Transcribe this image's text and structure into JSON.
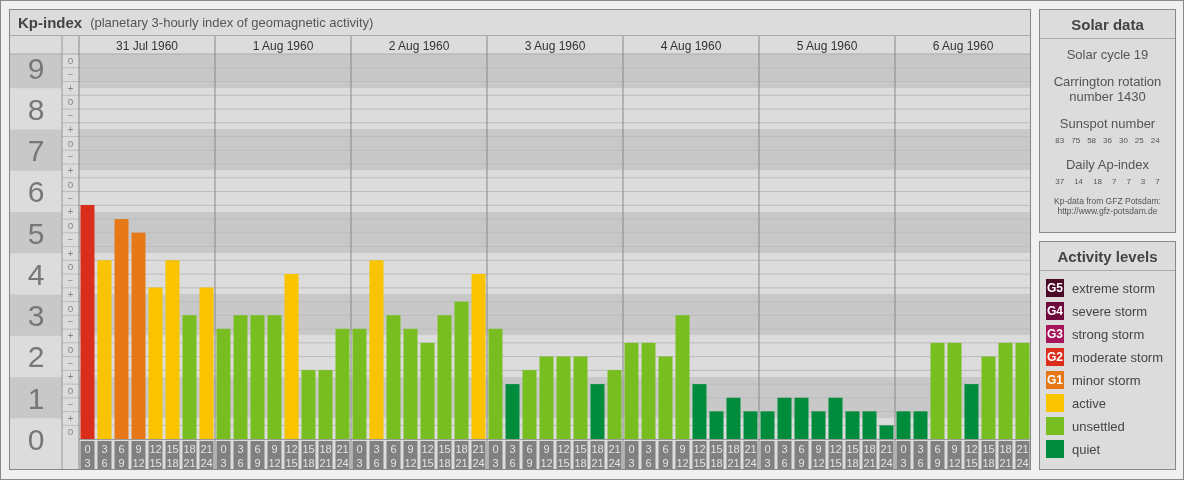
{
  "header": {
    "title": "Kp-index",
    "subtitle": "(planetary 3-hourly index of geomagnetic activity)"
  },
  "chart": {
    "sub_labels": [
      "o",
      "−",
      "+",
      "o",
      "−",
      "+",
      "o",
      "−",
      "+",
      "o",
      "−",
      "+",
      "o",
      "−",
      "+",
      "o",
      "−",
      "+",
      "o",
      "−",
      "+",
      "o",
      "−",
      "+",
      "o",
      "−",
      "+",
      "o"
    ],
    "days": [
      {
        "date": "31 Jul 1960",
        "slots": [
          {
            "from": "0",
            "to": "3"
          },
          {
            "from": "3",
            "to": "6"
          },
          {
            "from": "6",
            "to": "9"
          },
          {
            "from": "9",
            "to": "12"
          },
          {
            "from": "12",
            "to": "15"
          },
          {
            "from": "15",
            "to": "18"
          },
          {
            "from": "18",
            "to": "21"
          },
          {
            "from": "21",
            "to": "24"
          }
        ]
      },
      {
        "date": "1 Aug 1960",
        "slots": [
          {
            "from": "0",
            "to": "3"
          },
          {
            "from": "3",
            "to": "6"
          },
          {
            "from": "6",
            "to": "9"
          },
          {
            "from": "9",
            "to": "12"
          },
          {
            "from": "12",
            "to": "15"
          },
          {
            "from": "15",
            "to": "18"
          },
          {
            "from": "18",
            "to": "21"
          },
          {
            "from": "21",
            "to": "24"
          }
        ]
      },
      {
        "date": "2 Aug 1960",
        "slots": [
          {
            "from": "0",
            "to": "3"
          },
          {
            "from": "3",
            "to": "6"
          },
          {
            "from": "6",
            "to": "9"
          },
          {
            "from": "9",
            "to": "12"
          },
          {
            "from": "12",
            "to": "15"
          },
          {
            "from": "15",
            "to": "18"
          },
          {
            "from": "18",
            "to": "21"
          },
          {
            "from": "21",
            "to": "24"
          }
        ]
      },
      {
        "date": "3 Aug 1960",
        "slots": [
          {
            "from": "0",
            "to": "3"
          },
          {
            "from": "3",
            "to": "6"
          },
          {
            "from": "6",
            "to": "9"
          },
          {
            "from": "9",
            "to": "12"
          },
          {
            "from": "12",
            "to": "15"
          },
          {
            "from": "15",
            "to": "18"
          },
          {
            "from": "18",
            "to": "21"
          },
          {
            "from": "21",
            "to": "24"
          }
        ]
      },
      {
        "date": "4 Aug 1960",
        "slots": [
          {
            "from": "0",
            "to": "3"
          },
          {
            "from": "3",
            "to": "6"
          },
          {
            "from": "6",
            "to": "9"
          },
          {
            "from": "9",
            "to": "12"
          },
          {
            "from": "12",
            "to": "15"
          },
          {
            "from": "15",
            "to": "18"
          },
          {
            "from": "18",
            "to": "21"
          },
          {
            "from": "21",
            "to": "24"
          }
        ]
      },
      {
        "date": "5 Aug 1960",
        "slots": [
          {
            "from": "0",
            "to": "3"
          },
          {
            "from": "3",
            "to": "6"
          },
          {
            "from": "6",
            "to": "9"
          },
          {
            "from": "9",
            "to": "12"
          },
          {
            "from": "12",
            "to": "15"
          },
          {
            "from": "15",
            "to": "18"
          },
          {
            "from": "18",
            "to": "21"
          },
          {
            "from": "21",
            "to": "24"
          }
        ]
      },
      {
        "date": "6 Aug 1960",
        "slots": [
          {
            "from": "0",
            "to": "3"
          },
          {
            "from": "3",
            "to": "6"
          },
          {
            "from": "6",
            "to": "9"
          },
          {
            "from": "9",
            "to": "12"
          },
          {
            "from": "12",
            "to": "15"
          },
          {
            "from": "15",
            "to": "18"
          },
          {
            "from": "18",
            "to": "21"
          },
          {
            "from": "21",
            "to": "24"
          }
        ]
      }
    ],
    "chart_data": {
      "type": "bar",
      "stacked": true,
      "grid": true,
      "ylim": [
        0,
        9.33
      ],
      "yticks": [
        {
          "value": 0,
          "label": "0"
        },
        {
          "value": 1,
          "label": "1"
        },
        {
          "value": 2,
          "label": "2"
        },
        {
          "value": 3,
          "label": "3"
        },
        {
          "value": 4,
          "label": "4"
        },
        {
          "value": 5,
          "label": "5"
        },
        {
          "value": 6,
          "label": "6"
        },
        {
          "value": 7,
          "label": "7"
        },
        {
          "value": 8,
          "label": "8"
        },
        {
          "value": 9,
          "label": "9"
        }
      ],
      "series": [
        {
          "color": "#d92e1c",
          "values": [
            5.67,
            null,
            null,
            null,
            null,
            null,
            null,
            null,
            null,
            null,
            null,
            null,
            null,
            null,
            null,
            null,
            null,
            null,
            null,
            null,
            null,
            null,
            null,
            null,
            null,
            null,
            null,
            null,
            null,
            null,
            null,
            null,
            null,
            null,
            null,
            null,
            null,
            null,
            null,
            null,
            null,
            null,
            null,
            null,
            null,
            null,
            null,
            null,
            null,
            null,
            null,
            null,
            null,
            null,
            null,
            null
          ]
        },
        {
          "color": "#e67817",
          "values": [
            null,
            null,
            5.33,
            5,
            null,
            null,
            null,
            null,
            null,
            null,
            null,
            null,
            null,
            null,
            null,
            null,
            null,
            null,
            null,
            null,
            null,
            null,
            null,
            null,
            null,
            null,
            null,
            null,
            null,
            null,
            null,
            null,
            null,
            null,
            null,
            null,
            null,
            null,
            null,
            null,
            null,
            null,
            null,
            null,
            null,
            null,
            null,
            null,
            null,
            null,
            null,
            null,
            null,
            null,
            null,
            null
          ]
        },
        {
          "color": "#f9c300",
          "values": [
            null,
            4.33,
            null,
            null,
            3.67,
            4.33,
            null,
            3.67,
            null,
            null,
            null,
            null,
            4,
            null,
            null,
            null,
            null,
            4.33,
            null,
            null,
            null,
            null,
            null,
            4,
            null,
            null,
            null,
            null,
            null,
            null,
            null,
            null,
            null,
            null,
            null,
            null,
            null,
            null,
            null,
            null,
            null,
            null,
            null,
            null,
            null,
            null,
            null,
            null,
            null,
            null,
            null,
            null,
            null,
            null,
            null,
            null
          ]
        },
        {
          "color": "#78be20",
          "values": [
            null,
            null,
            null,
            null,
            null,
            null,
            3,
            null,
            2.67,
            3,
            3,
            3,
            null,
            1.67,
            1.67,
            2.67,
            2.67,
            null,
            3,
            2.67,
            2.33,
            3,
            3.33,
            null,
            2.67,
            null,
            1.67,
            2,
            2,
            2,
            null,
            1.67,
            2.33,
            2.33,
            2,
            3,
            null,
            null,
            null,
            null,
            null,
            null,
            null,
            null,
            null,
            null,
            null,
            null,
            null,
            null,
            2.33,
            2.33,
            null,
            2,
            2.33,
            2.33
          ]
        },
        {
          "color": "#008c3c",
          "values": [
            null,
            null,
            null,
            null,
            null,
            null,
            null,
            null,
            null,
            null,
            null,
            null,
            null,
            null,
            null,
            null,
            null,
            null,
            null,
            null,
            null,
            null,
            null,
            null,
            null,
            1.33,
            null,
            null,
            null,
            null,
            1.33,
            null,
            null,
            null,
            null,
            null,
            1.33,
            0.67,
            1,
            0.67,
            0.67,
            1,
            1,
            0.67,
            1,
            0.67,
            0.67,
            0.33,
            0.67,
            0.67,
            null,
            null,
            1.33,
            null,
            null,
            null
          ]
        }
      ]
    }
  },
  "solar_data": {
    "title": "Solar data",
    "cycle": "Solar cycle 19",
    "rotation": "Carrington rotation number 1430",
    "sunspot_label": "Sunspot number",
    "sunspot_values": [
      "83",
      "75",
      "58",
      "36",
      "30",
      "25",
      "24"
    ],
    "ap_label": "Daily Ap-index",
    "ap_values": [
      "37",
      "14",
      "18",
      "7",
      "7",
      "3",
      "7"
    ],
    "credit_lines": [
      "Kp-data from GFZ Potsdam:",
      "http://www.gfz-potsdam.de"
    ]
  },
  "activity_levels": {
    "title": "Activity levels",
    "items": [
      {
        "badge": "G5",
        "label": "extreme storm",
        "color": "#4b0a28"
      },
      {
        "badge": "G4",
        "label": "severe storm",
        "color": "#6e0a3c"
      },
      {
        "badge": "G3",
        "label": "strong storm",
        "color": "#a8145a"
      },
      {
        "badge": "G2",
        "label": "moderate storm",
        "color": "#d92e1c"
      },
      {
        "badge": "G1",
        "label": "minor storm",
        "color": "#e67817"
      },
      {
        "label": "active",
        "color": "#f9c300"
      },
      {
        "label": "unsettled",
        "color": "#78be20"
      },
      {
        "label": "quiet",
        "color": "#008c3c"
      }
    ]
  }
}
